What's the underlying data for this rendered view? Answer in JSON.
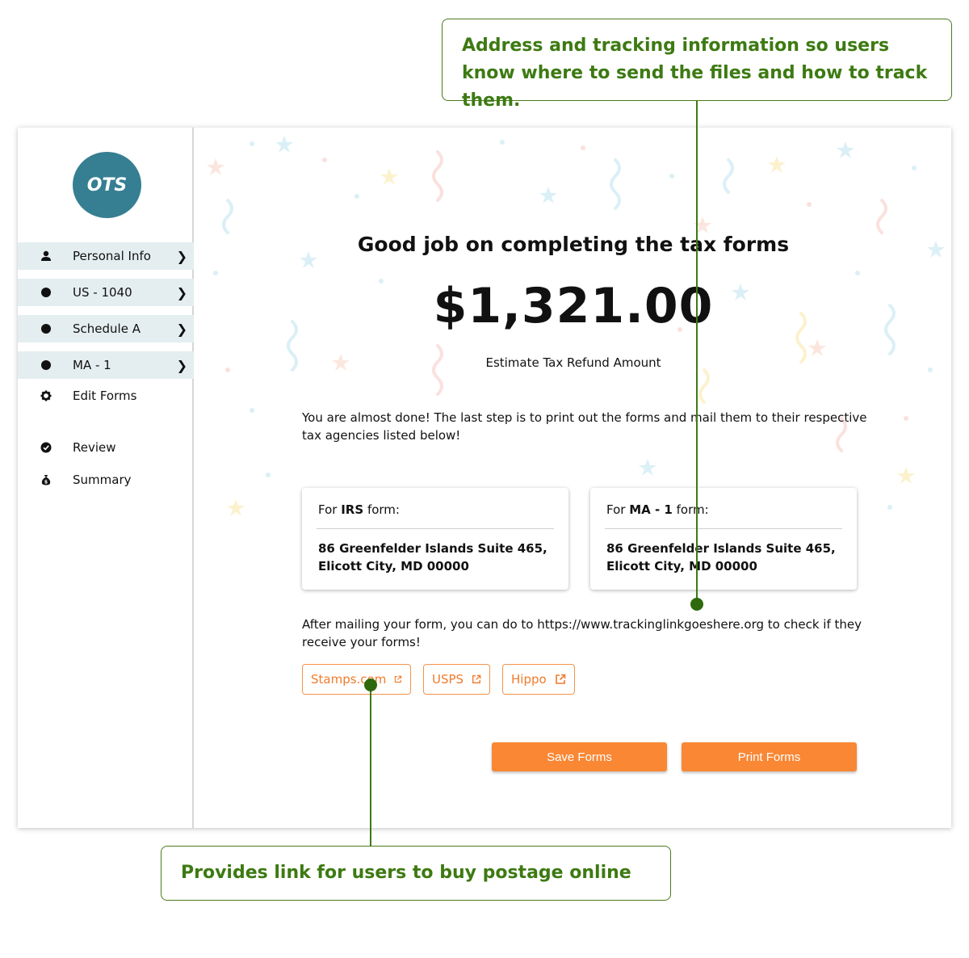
{
  "annotations": {
    "top_callout": "Address and tracking information so users know where to send the files and how to track them.",
    "bottom_callout": "Provides link for users to buy postage online"
  },
  "sidebar": {
    "logo_text": "OTS",
    "items": [
      {
        "label": "Personal Info",
        "icon": "user-icon"
      },
      {
        "label": "US - 1040",
        "icon": "bullet-icon"
      },
      {
        "label": "Schedule A",
        "icon": "bullet-icon"
      },
      {
        "label": "MA - 1",
        "icon": "bullet-icon"
      },
      {
        "label": "Edit Forms",
        "icon": "gear-icon"
      },
      {
        "label": "Review",
        "icon": "check-circle-icon"
      },
      {
        "label": "Summary",
        "icon": "money-bag-icon"
      }
    ]
  },
  "main": {
    "headline": "Good job on completing the tax forms",
    "refund_amount": "$1,321.00",
    "refund_label": "Estimate Tax Refund Amount",
    "instructions": "You are almost done! The last step is to print out the forms and mail them to their respective tax agencies listed below!",
    "cards": [
      {
        "prefix": "For",
        "form": "IRS",
        "suffix": "form:",
        "address_line1": "86 Greenfelder Islands Suite 465,",
        "address_line2": "Elicott City, MD 00000"
      },
      {
        "prefix": "For",
        "form": "MA - 1",
        "suffix": "form:",
        "address_line1": "86 Greenfelder Islands Suite 465,",
        "address_line2": "Elicott City, MD 00000"
      }
    ],
    "tracking_text": "After mailing your form, you can do to https://www.trackinglinkgoeshere.org to check if they receive your forms!",
    "postage_links": [
      "Stamps.com",
      "USPS",
      "Hippo"
    ],
    "save_label": "Save Forms",
    "print_label": "Print Forms"
  },
  "colors": {
    "accent_orange": "#f98734",
    "logo_teal": "#367e92",
    "callout_green": "#3d7a12",
    "nav_highlight": "#e4eef0"
  }
}
